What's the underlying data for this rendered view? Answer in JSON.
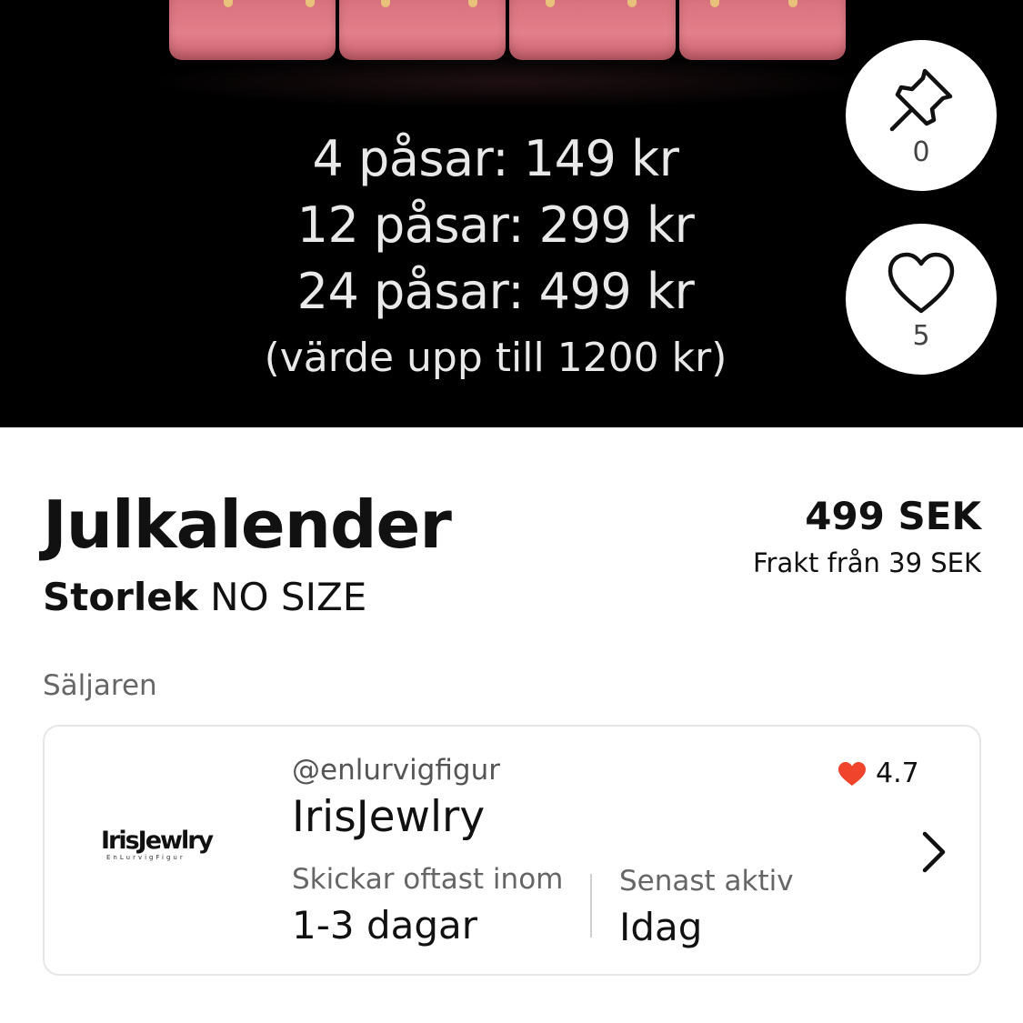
{
  "hero": {
    "price_lines": [
      "4 påsar: 149 kr",
      "12 påsar: 299 kr",
      "24 påsar: 499 kr"
    ],
    "value_note": "(värde upp till 1200 kr)",
    "pin": {
      "icon": "pin-icon",
      "count": "0"
    },
    "like": {
      "icon": "heart-outline-icon",
      "count": "5"
    }
  },
  "listing": {
    "title": "Julkalender",
    "size_label": "Storlek",
    "size_value": "NO SIZE",
    "price": "499 SEK",
    "shipping": "Frakt från  39 SEK"
  },
  "seller": {
    "heading": "Säljaren",
    "logo_text": "IrisJewlry",
    "logo_subtext": "EnLurvigFigur",
    "handle": "@enlurvigfigur",
    "name": "IrisJewlry",
    "rating": "4.7",
    "rating_icon": "heart-filled-icon",
    "rating_color": "#f0442c",
    "ships_label": "Skickar oftast inom",
    "ships_value": "1-3 dagar",
    "active_label": "Senast aktiv",
    "active_value": "Idag"
  }
}
